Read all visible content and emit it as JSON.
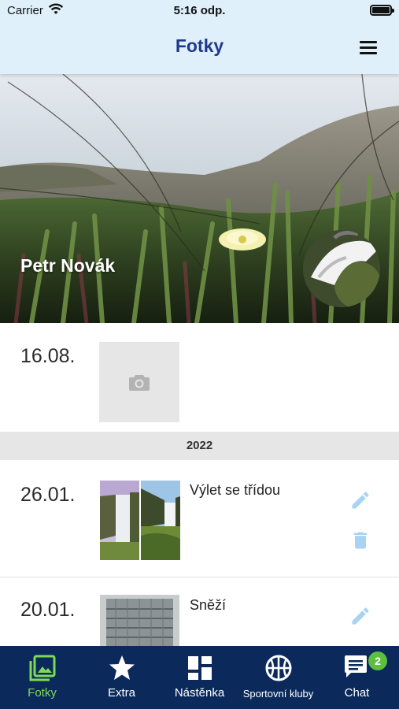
{
  "status_bar": {
    "carrier": "Carrier",
    "time": "5:16 odp."
  },
  "header": {
    "title": "Fotky"
  },
  "profile": {
    "name": "Petr Novák"
  },
  "albums": [
    {
      "date": "16.08.",
      "title": "",
      "has_photos": false
    },
    {
      "date": "26.01.",
      "title": "Výlet se třídou",
      "has_photos": true
    },
    {
      "date": "20.01.",
      "title": "Sněží",
      "has_photos": true
    }
  ],
  "year_separator": "2022",
  "tabs": [
    {
      "label": "Fotky",
      "icon": "photos-icon",
      "active": true
    },
    {
      "label": "Extra",
      "icon": "star-icon",
      "active": false
    },
    {
      "label": "Nástěnka",
      "icon": "dashboard-icon",
      "active": false
    },
    {
      "label": "Sportovní kluby",
      "icon": "basketball-icon",
      "active": false
    },
    {
      "label": "Chat",
      "icon": "chat-icon",
      "active": false,
      "badge": "2"
    }
  ],
  "colors": {
    "header_bg": "#dff0fa",
    "title": "#1f3a8a",
    "tabbar_bg": "#0b2a5b",
    "active_tab": "#7ed957",
    "action_icon": "#a9d3f2",
    "badge": "#5cbf3f"
  }
}
